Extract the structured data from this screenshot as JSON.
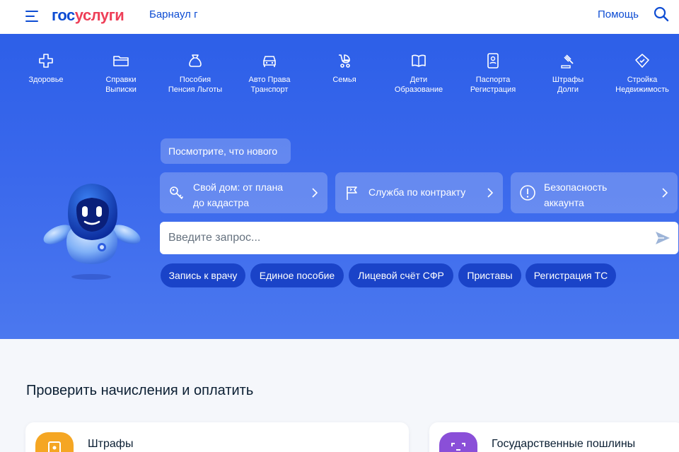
{
  "header": {
    "logo": {
      "part1": "гос",
      "part2": "услуги"
    },
    "city": "Барнаул г",
    "help": "Помощь"
  },
  "categories": [
    {
      "label": "Здоровье",
      "icon": "health-cross-icon"
    },
    {
      "label": "Справки\nВыписки",
      "icon": "folder-icon"
    },
    {
      "label": "Пособия\nПенсия Льготы",
      "icon": "money-bag-icon"
    },
    {
      "label": "Авто Права\nТранспорт",
      "icon": "car-icon"
    },
    {
      "label": "Семья",
      "icon": "stroller-icon"
    },
    {
      "label": "Дети\nОбразование",
      "icon": "book-icon"
    },
    {
      "label": "Паспорта\nРегистрация",
      "icon": "passport-icon"
    },
    {
      "label": "Штрафы\nДолги",
      "icon": "gavel-icon"
    },
    {
      "label": "Стройка\nНедвижимость",
      "icon": "house-icon"
    }
  ],
  "hero": {
    "whats_new": "Посмотрите, что нового",
    "promos": [
      {
        "text": "Свой дом: от плана\nдо кадастра",
        "icon": "key-icon"
      },
      {
        "text": "Служба по контракту",
        "icon": "flag-icon"
      },
      {
        "text": "Безопасность\nаккаунта",
        "icon": "info-circle-icon"
      }
    ],
    "search_placeholder": "Введите запрос...",
    "chips": [
      "Запись к врачу",
      "Единое пособие",
      "Лицевой счёт СФР",
      "Приставы",
      "Регистрация ТС"
    ]
  },
  "payments": {
    "title": "Проверить начисления и оплатить",
    "cards": [
      {
        "title": "Штрафы",
        "icon": "fine-doc-icon",
        "color": "#f5a623"
      },
      {
        "title": "Государственные пошлины",
        "icon": "duty-icon",
        "color": "#8a4fd8"
      }
    ]
  },
  "colors": {
    "brand_blue": "#0d4cd3",
    "brand_red": "#ee3f58",
    "hero_blue": "#3a68ec"
  }
}
